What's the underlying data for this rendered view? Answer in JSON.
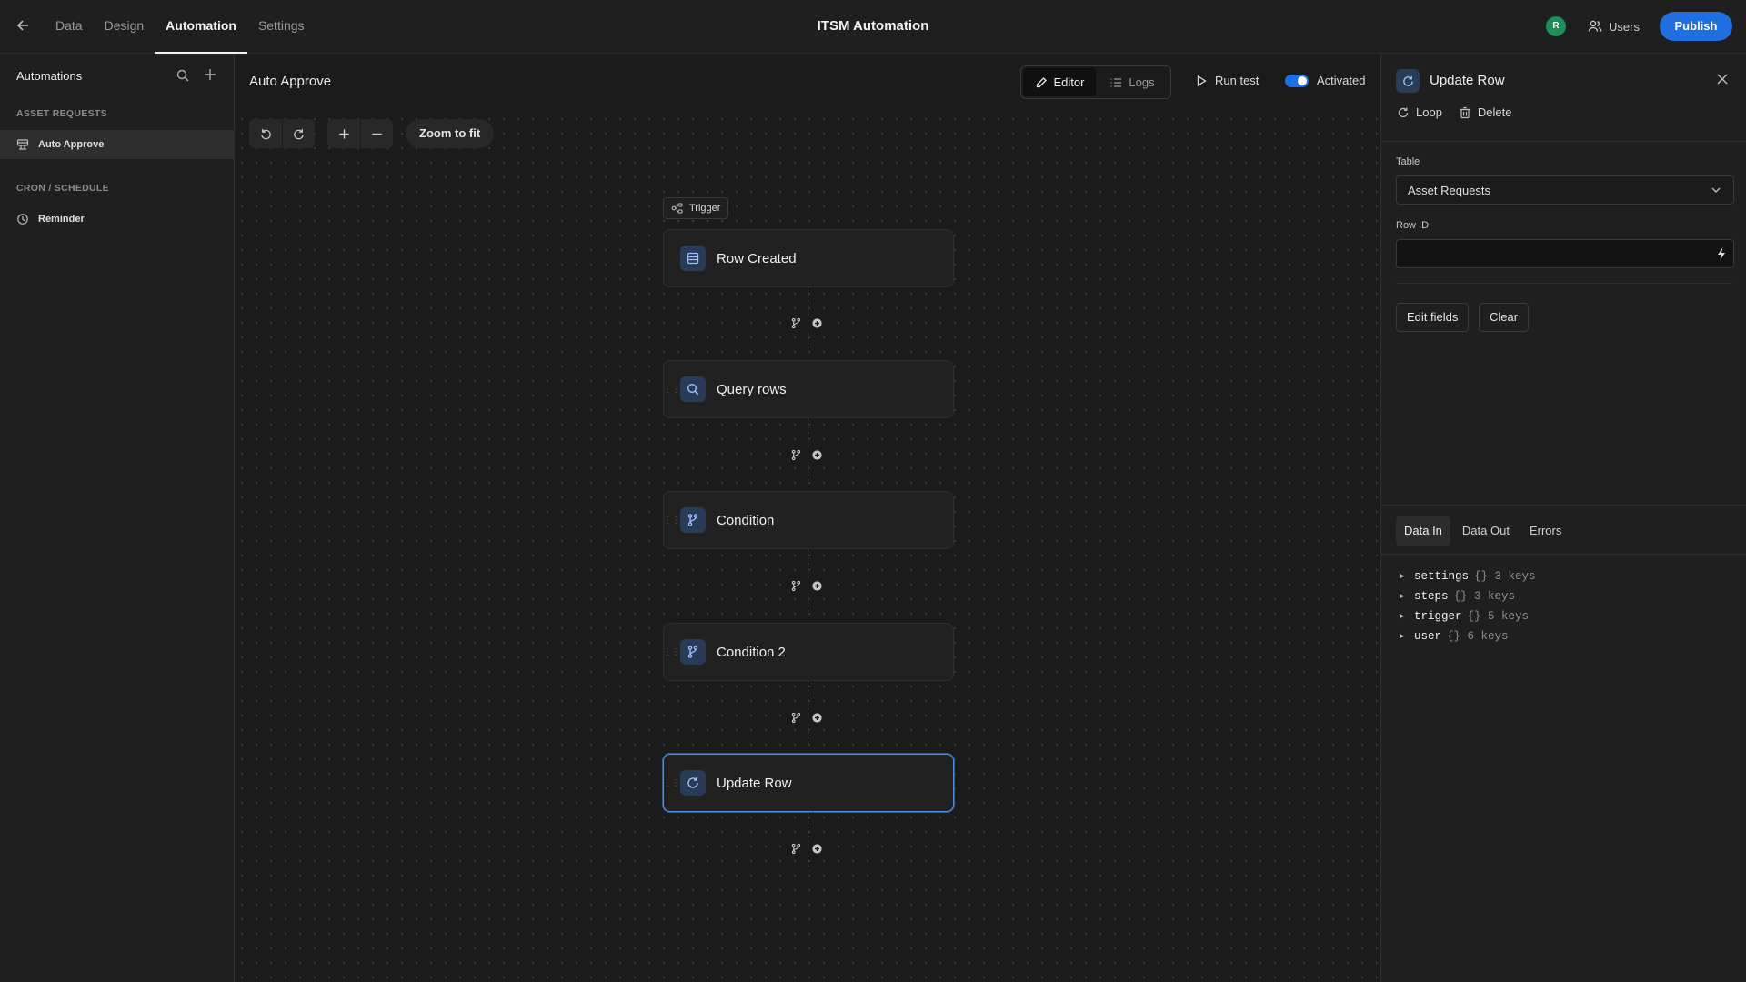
{
  "header": {
    "nav": [
      "Data",
      "Design",
      "Automation",
      "Settings"
    ],
    "active_nav": "Automation",
    "app_title": "ITSM Automation",
    "avatar_initial": "R",
    "users_label": "Users",
    "publish_label": "Publish",
    "accent_color": "#1f6fe0"
  },
  "sidebar": {
    "title": "Automations",
    "sections": [
      {
        "title": "ASSET REQUESTS",
        "items": [
          {
            "label": "Auto Approve",
            "icon": "table-icon",
            "active": true
          }
        ]
      },
      {
        "title": "CRON / SCHEDULE",
        "items": [
          {
            "label": "Reminder",
            "icon": "clock-icon",
            "active": false
          }
        ]
      }
    ]
  },
  "canvas": {
    "automation_name": "Auto Approve",
    "modes": [
      "Editor",
      "Logs"
    ],
    "active_mode": "Editor",
    "run_test_label": "Run test",
    "activated_label": "Activated",
    "activated": true,
    "zoom_fit_label": "Zoom to fit",
    "trigger_tag": "Trigger",
    "nodes": [
      {
        "label": "Row Created",
        "icon": "table-row-icon",
        "selected": false
      },
      {
        "label": "Query rows",
        "icon": "search-icon",
        "selected": false
      },
      {
        "label": "Condition",
        "icon": "branch-icon",
        "selected": false
      },
      {
        "label": "Condition 2",
        "icon": "branch-icon",
        "selected": false
      },
      {
        "label": "Update Row",
        "icon": "refresh-icon",
        "selected": true
      }
    ]
  },
  "panel": {
    "title": "Update Row",
    "loop_label": "Loop",
    "delete_label": "Delete",
    "table_label": "Table",
    "table_value": "Asset Requests",
    "row_id_label": "Row ID",
    "row_id_value": "",
    "edit_fields_label": "Edit fields",
    "clear_label": "Clear",
    "data_tabs": [
      "Data In",
      "Data Out",
      "Errors"
    ],
    "active_data_tab": "Data In",
    "tree": [
      {
        "key": "settings",
        "meta": "{} 3 keys"
      },
      {
        "key": "steps",
        "meta": "{} 3 keys"
      },
      {
        "key": "trigger",
        "meta": "{} 5 keys"
      },
      {
        "key": "user",
        "meta": "{} 6 keys"
      }
    ]
  }
}
